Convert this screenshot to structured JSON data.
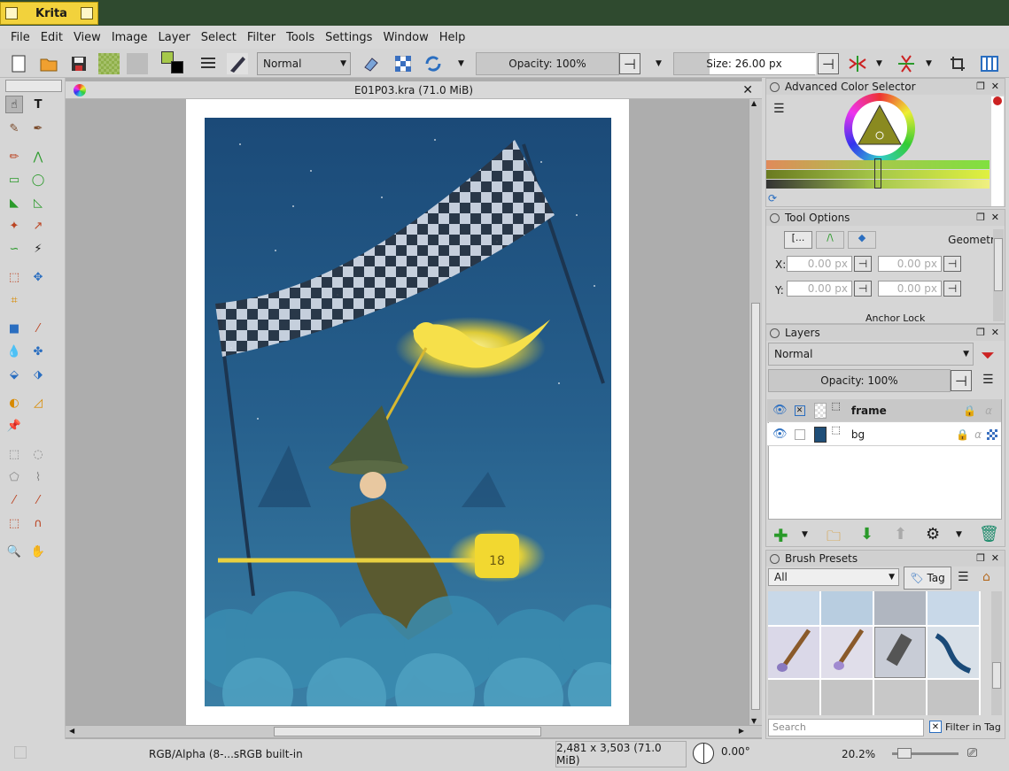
{
  "app": {
    "title": "Krita"
  },
  "menu": [
    "File",
    "Edit",
    "View",
    "Image",
    "Layer",
    "Select",
    "Filter",
    "Tools",
    "Settings",
    "Window",
    "Help"
  ],
  "toolbar": {
    "blend_mode": "Normal",
    "opacity": "Opacity: 100%",
    "size": "Size: 26.00 px",
    "fg_color": "#a6c84a",
    "bg_color": "#000000"
  },
  "document": {
    "tab_title": "E01P03.kra (71.0 MiB)"
  },
  "color_selector": {
    "title": "Advanced Color Selector"
  },
  "tool_options": {
    "title": "Tool Options",
    "tabs": [
      "[...",
      "/\\",
      "◆"
    ],
    "section": "Geometry",
    "x_label": "X:",
    "y_label": "Y:",
    "x1": "0.00 px",
    "x2": "0.00 px",
    "y1": "0.00 px",
    "y2": "0.00 px",
    "anchor_lock": "Anchor Lock"
  },
  "layers": {
    "title": "Layers",
    "blend_mode": "Normal",
    "opacity": "Opacity:  100%",
    "items": [
      {
        "name": "frame",
        "selected": true
      },
      {
        "name": "bg",
        "selected": false
      }
    ]
  },
  "brush_presets": {
    "title": "Brush Presets",
    "filter": "All",
    "tag_button": "Tag",
    "search_placeholder": "Search",
    "filter_in_tag": "Filter in Tag"
  },
  "status": {
    "color_model": "RGB/Alpha (8-...sRGB built-in",
    "image_size": "2,481 x 3,503 (71.0 MiB)",
    "rotation": "0.00°",
    "zoom": "20.2%"
  },
  "art": {
    "number_label": "18"
  }
}
